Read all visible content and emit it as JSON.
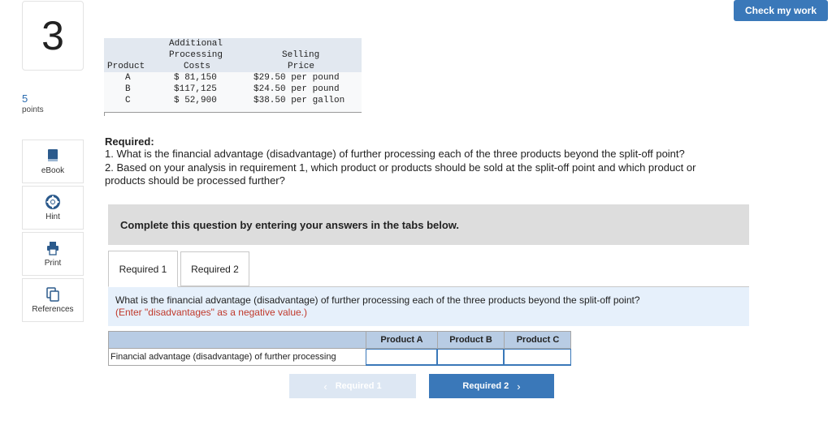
{
  "question": {
    "number": "3",
    "points_value": "5",
    "points_label": "points"
  },
  "toolbar": {
    "check_label": "Check my work",
    "tools": [
      {
        "label": "eBook",
        "icon": "book-icon"
      },
      {
        "label": "Hint",
        "icon": "lifebuoy-icon"
      },
      {
        "label": "Print",
        "icon": "printer-icon"
      },
      {
        "label": "References",
        "icon": "copy-icon"
      }
    ]
  },
  "data_table": {
    "headers": {
      "product": "Product",
      "costs": [
        "Additional",
        "Processing",
        "Costs"
      ],
      "price": [
        "Selling",
        "Price"
      ]
    },
    "rows": [
      {
        "product": "A",
        "cost": "$ 81,150",
        "price": "$29.50 per pound"
      },
      {
        "product": "B",
        "cost": "$117,125",
        "price": "$24.50 per pound"
      },
      {
        "product": "C",
        "cost": "$ 52,900",
        "price": "$38.50 per gallon"
      }
    ]
  },
  "required": {
    "title": "Required:",
    "line1": "1. What is the financial advantage (disadvantage) of further processing each of the three products beyond the split-off point?",
    "line2": "2. Based on your analysis in requirement 1, which product or products should be sold at the split-off point and which product or",
    "line3": "products should be processed further?"
  },
  "banner": "Complete this question by entering your answers in the tabs below.",
  "tabs": [
    {
      "label": "Required 1"
    },
    {
      "label": "Required 2"
    }
  ],
  "question_area": {
    "text": "What is the financial advantage (disadvantage) of further processing each of the three products beyond the split-off point?",
    "note": "(Enter \"disadvantages\" as a negative value.)"
  },
  "answer_table": {
    "columns": [
      "Product A",
      "Product B",
      "Product C"
    ],
    "row_label": "Financial advantage (disadvantage) of further processing",
    "values": [
      "",
      "",
      ""
    ]
  },
  "nav": {
    "prev_label": "Required 1",
    "next_label": "Required 2"
  },
  "colors": {
    "accent": "#3a78b9",
    "note_red": "#c0392b",
    "header_blue": "#b8cce4"
  }
}
